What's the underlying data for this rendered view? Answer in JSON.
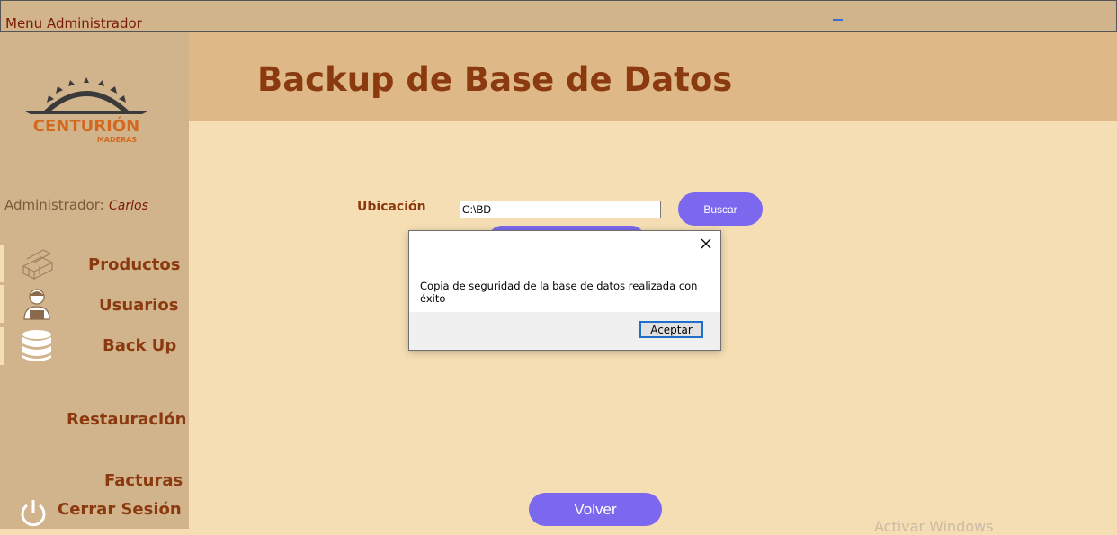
{
  "window": {
    "title": "Menu Administrador"
  },
  "brand": {
    "name": "CENTURIÓN",
    "sub": "MADERAS"
  },
  "user": {
    "label": "Administrador:",
    "name": "Carlos"
  },
  "nav": {
    "productos": "Productos",
    "usuarios": "Usuarios",
    "backup": "Back Up",
    "restauracion": "Restauración",
    "facturas": "Facturas",
    "logout": "Cerrar Sesión"
  },
  "header": {
    "title": "Backup de Base de Datos"
  },
  "form": {
    "location_label": "Ubicación",
    "location_value": "C:\\BD",
    "browse_button": "Buscar",
    "back_button": "Volver"
  },
  "dialog": {
    "message": "Copia de seguridad de la base de datos realizada con éxito",
    "ok_button": "Aceptar"
  },
  "watermark": "Activar Windows",
  "colors": {
    "accent": "#7b68ee",
    "title": "#8b3a0f",
    "sidebar": "#d2b48c",
    "header": "#deb887",
    "content": "#f5deb3"
  }
}
